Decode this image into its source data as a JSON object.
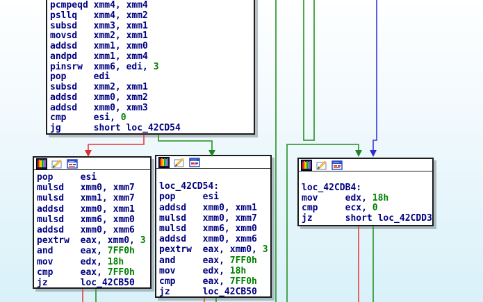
{
  "app": {
    "name": "ida-graph-view"
  },
  "colors": {
    "block_bg": "#ffffff",
    "block_border": "#1b1b1b",
    "block_shadow": "rgba(128,140,150,0.55)",
    "text_code": "#000080",
    "text_imm": "#008000",
    "edge_red": "#e85050",
    "edge_green": "#3a9c3a",
    "edge_blue": "#4c4ce0",
    "arrow_red": "#dd2c2c",
    "arrow_green": "#1e861e",
    "arrow_blue": "#2d2dcf"
  },
  "titlebar_icons": [
    "color-palette-icon",
    "edit-node-icon",
    "open-window-icon"
  ],
  "blocks": [
    {
      "id": "top",
      "titlebar": false,
      "lines": [
        [
          {
            "t": "pcmpeqd xmm4, xmm4",
            "c": "code"
          }
        ],
        [
          {
            "t": "psllq   xmm4, xmm2",
            "c": "code"
          }
        ],
        [
          {
            "t": "subsd   xmm3, xmm1",
            "c": "code"
          }
        ],
        [
          {
            "t": "movsd   xmm2, xmm1",
            "c": "code"
          }
        ],
        [
          {
            "t": "addsd   xmm1, xmm0",
            "c": "code"
          }
        ],
        [
          {
            "t": "andpd   xmm1, xmm4",
            "c": "code"
          }
        ],
        [
          {
            "t": "pinsrw  xmm6, edi, ",
            "c": "code"
          },
          {
            "t": "3",
            "c": "imm"
          }
        ],
        [
          {
            "t": "pop     edi",
            "c": "code"
          }
        ],
        [
          {
            "t": "subsd   xmm2, xmm1",
            "c": "code"
          }
        ],
        [
          {
            "t": "addsd   xmm0, xmm2",
            "c": "code"
          }
        ],
        [
          {
            "t": "addsd   xmm0, xmm3",
            "c": "code"
          }
        ],
        [
          {
            "t": "cmp     esi, ",
            "c": "code"
          },
          {
            "t": "0",
            "c": "imm"
          }
        ],
        [
          {
            "t": "jg      short loc_42CD54",
            "c": "code"
          }
        ]
      ]
    },
    {
      "id": "left",
      "titlebar": true,
      "lines": [
        [
          {
            "t": "pop     esi",
            "c": "code"
          }
        ],
        [
          {
            "t": "mulsd   xmm0, xmm7",
            "c": "code"
          }
        ],
        [
          {
            "t": "mulsd   xmm1, xmm7",
            "c": "code"
          }
        ],
        [
          {
            "t": "addsd   xmm0, xmm1",
            "c": "code"
          }
        ],
        [
          {
            "t": "mulsd   xmm6, xmm0",
            "c": "code"
          }
        ],
        [
          {
            "t": "addsd   xmm0, xmm6",
            "c": "code"
          }
        ],
        [
          {
            "t": "pextrw  eax, xmm0, ",
            "c": "code"
          },
          {
            "t": "3",
            "c": "imm"
          }
        ],
        [
          {
            "t": "and     eax, ",
            "c": "code"
          },
          {
            "t": "7FF0h",
            "c": "imm"
          }
        ],
        [
          {
            "t": "mov     edx, ",
            "c": "code"
          },
          {
            "t": "18h",
            "c": "imm"
          }
        ],
        [
          {
            "t": "cmp     eax, ",
            "c": "code"
          },
          {
            "t": "7FF0h",
            "c": "imm"
          }
        ],
        [
          {
            "t": "jz      loc_42CB50",
            "c": "code"
          }
        ]
      ]
    },
    {
      "id": "middle",
      "titlebar": true,
      "lines": [
        [],
        [
          {
            "t": "loc_42CD54:",
            "c": "code"
          }
        ],
        [
          {
            "t": "pop     esi",
            "c": "code"
          }
        ],
        [
          {
            "t": "addsd   xmm0, xmm1",
            "c": "code"
          }
        ],
        [
          {
            "t": "mulsd   xmm0, xmm7",
            "c": "code"
          }
        ],
        [
          {
            "t": "mulsd   xmm6, xmm0",
            "c": "code"
          }
        ],
        [
          {
            "t": "addsd   xmm0, xmm6",
            "c": "code"
          }
        ],
        [
          {
            "t": "pextrw  eax, xmm0, ",
            "c": "code"
          },
          {
            "t": "3",
            "c": "imm"
          }
        ],
        [
          {
            "t": "and     eax, ",
            "c": "code"
          },
          {
            "t": "7FF0h",
            "c": "imm"
          }
        ],
        [
          {
            "t": "mov     edx, ",
            "c": "code"
          },
          {
            "t": "18h",
            "c": "imm"
          }
        ],
        [
          {
            "t": "cmp     eax, ",
            "c": "code"
          },
          {
            "t": "7FF0h",
            "c": "imm"
          }
        ],
        [
          {
            "t": "jz      loc_42CB50",
            "c": "code"
          }
        ]
      ]
    },
    {
      "id": "right",
      "titlebar": true,
      "lines": [
        [],
        [
          {
            "t": "loc_42CDB4:",
            "c": "code"
          }
        ],
        [
          {
            "t": "mov     edx, ",
            "c": "code"
          },
          {
            "t": "18h",
            "c": "imm"
          }
        ],
        [
          {
            "t": "cmp     ecx, ",
            "c": "code"
          },
          {
            "t": "0",
            "c": "imm"
          }
        ],
        [
          {
            "t": "jz      short loc_42CDD3",
            "c": "code"
          }
        ]
      ]
    }
  ]
}
